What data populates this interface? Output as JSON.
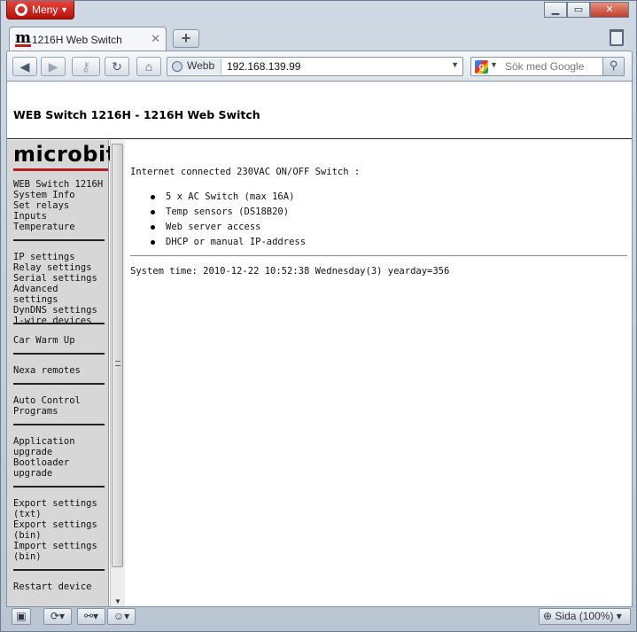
{
  "browser": {
    "menu_label": "Meny",
    "tab_title": "1216H Web Switch",
    "address_label": "Webb",
    "url": "192.168.139.99",
    "search_placeholder": "Sök med Google",
    "zoom_label": "Sida (100%)"
  },
  "page": {
    "header_title": "WEB Switch 1216H - 1216H Web Switch",
    "logo_text": "microbit",
    "intro": "Internet connected 230VAC ON/OFF Switch :",
    "features": [
      "5 x AC Switch (max 16A)",
      "Temp sensors (DS18B20)",
      "Web server access",
      "DHCP or manual IP-address"
    ],
    "system_time": "System time: 2010-12-22 10:52:38 Wednesday(3) yearday=356"
  },
  "sidebar": {
    "group1": [
      "WEB Switch 1216H",
      "System Info",
      "Set relays",
      "Inputs",
      "Temperature"
    ],
    "group2": [
      "IP settings",
      "Relay settings",
      "Serial settings",
      "Advanced settings",
      "DynDNS settings",
      "1-wire devices"
    ],
    "group3": [
      "Car Warm Up"
    ],
    "group4": [
      "Nexa remotes"
    ],
    "group5": [
      "Auto Control",
      "Programs"
    ],
    "group6": [
      "Application",
      "upgrade",
      "Bootloader",
      "upgrade"
    ],
    "group7": [
      "Export settings",
      "(txt)",
      "Export settings",
      "(bin)",
      "Import settings",
      "(bin)"
    ],
    "group8": [
      "Restart device"
    ]
  },
  "colors": {
    "accent": "#b3221e",
    "sidebar_bg": "#d7d7d7"
  }
}
